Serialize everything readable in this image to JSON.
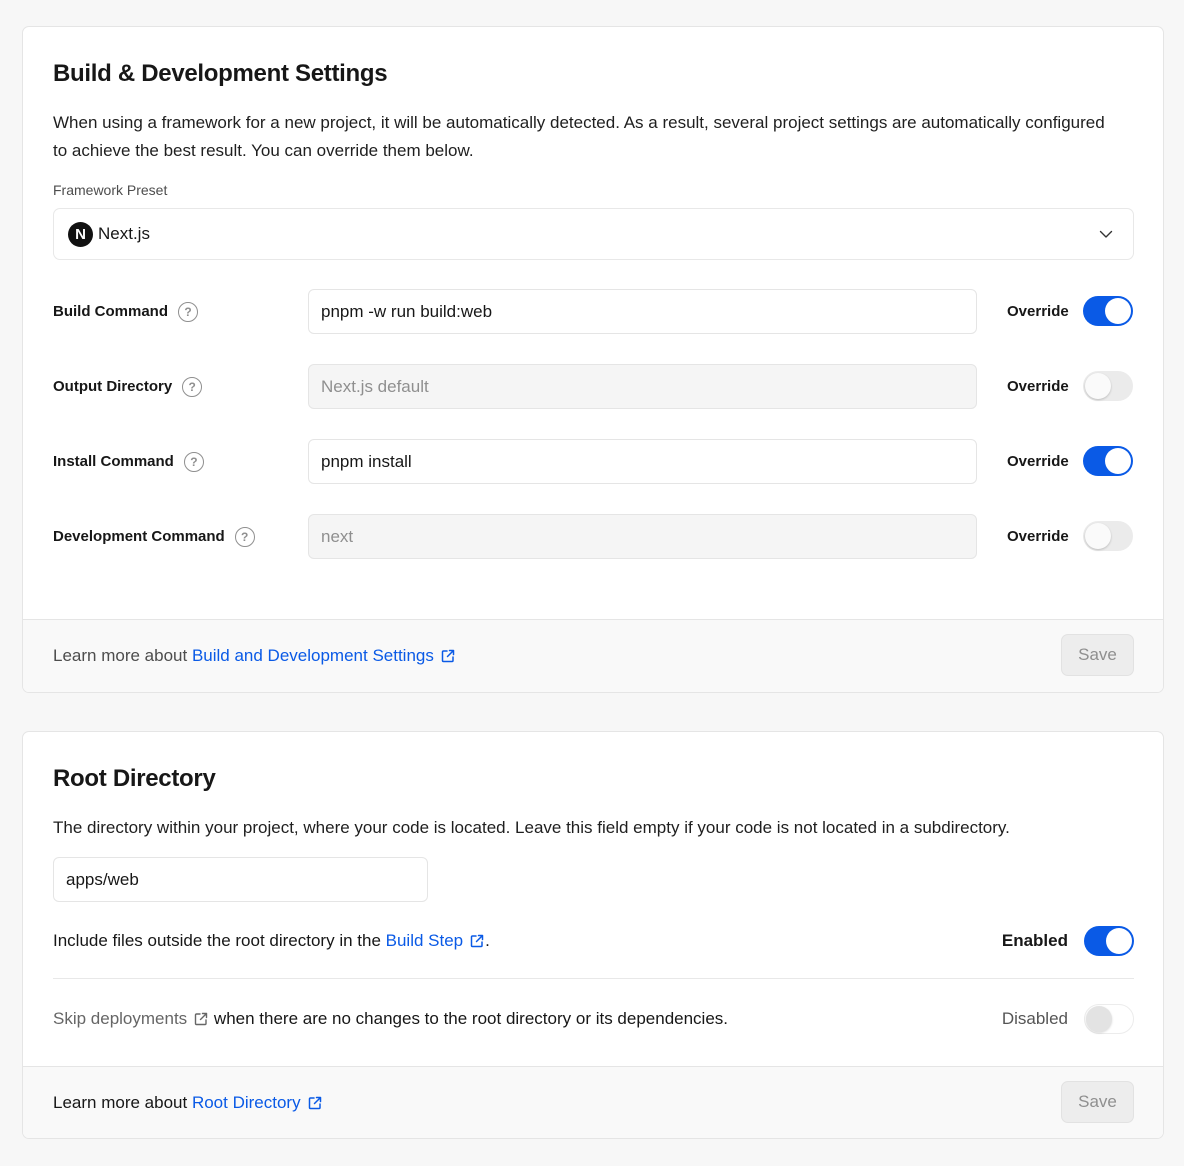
{
  "build_settings": {
    "title": "Build & Development Settings",
    "description": "When using a framework for a new project, it will be automatically detected. As a result, several project settings are automatically configured to achieve the best result. You can override them below.",
    "framework_preset": {
      "label": "Framework Preset",
      "value": "Next.js",
      "logo_letter": "N"
    },
    "rows": [
      {
        "label": "Build Command",
        "value": "pnpm -w run build:web",
        "placeholder": "",
        "override_label": "Override",
        "override_on": true
      },
      {
        "label": "Output Directory",
        "value": "",
        "placeholder": "Next.js default",
        "override_label": "Override",
        "override_on": false
      },
      {
        "label": "Install Command",
        "value": "pnpm install",
        "placeholder": "",
        "override_label": "Override",
        "override_on": true
      },
      {
        "label": "Development Command",
        "value": "",
        "placeholder": "next",
        "override_label": "Override",
        "override_on": false
      }
    ],
    "footer": {
      "prefix": "Learn more about",
      "link_text": "Build and Development Settings",
      "save_label": "Save"
    }
  },
  "root_directory": {
    "title": "Root Directory",
    "description": "The directory within your project, where your code is located. Leave this field empty if your code is not located in a subdirectory.",
    "input_value": "apps/web",
    "include_files": {
      "prefix": "Include files outside the root directory in the",
      "link_text": "Build Step",
      "suffix": ".",
      "state_label": "Enabled",
      "on": true
    },
    "skip_deployments": {
      "link_text": "Skip deployments",
      "suffix": "when there are no changes to the root directory or its dependencies.",
      "state_label": "Disabled",
      "on": false
    },
    "footer": {
      "prefix": "Learn more about",
      "link_text": "Root Directory",
      "save_label": "Save"
    }
  },
  "colors": {
    "accent": "#0a5ae6",
    "page_background": "#f7f7f7",
    "card_background": "#ffffff",
    "footer_background": "#f9f9f9"
  }
}
